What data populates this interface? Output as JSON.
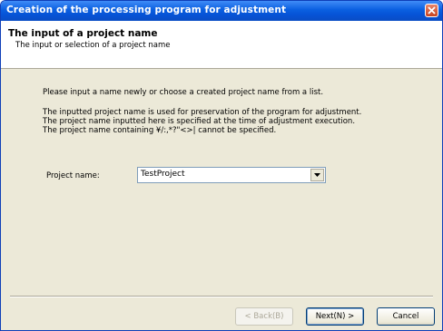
{
  "window": {
    "title": "Creation of the processing program for adjustment"
  },
  "header": {
    "title": "The input of a project name",
    "subtitle": "The input or selection of a project name"
  },
  "body": {
    "instruction": "Please input a name newly or choose a created project name from a list.",
    "note_line1": "The inputted project name is used for preservation of the program for adjustment.",
    "note_line2": "The project name inputted here is specified at the time of adjustment execution.",
    "note_line3": "The project name containing ¥/:,*?\"<>| cannot be specified."
  },
  "form": {
    "project_label": "Project name:",
    "project_value": "TestProject"
  },
  "footer": {
    "back_label": "< Back(B)",
    "next_label": "Next(N) >",
    "cancel_label": "Cancel"
  },
  "colors": {
    "titlebar": "#0a5fe0",
    "dialog_bg": "#ece9d8",
    "close_button": "#c8431f"
  }
}
